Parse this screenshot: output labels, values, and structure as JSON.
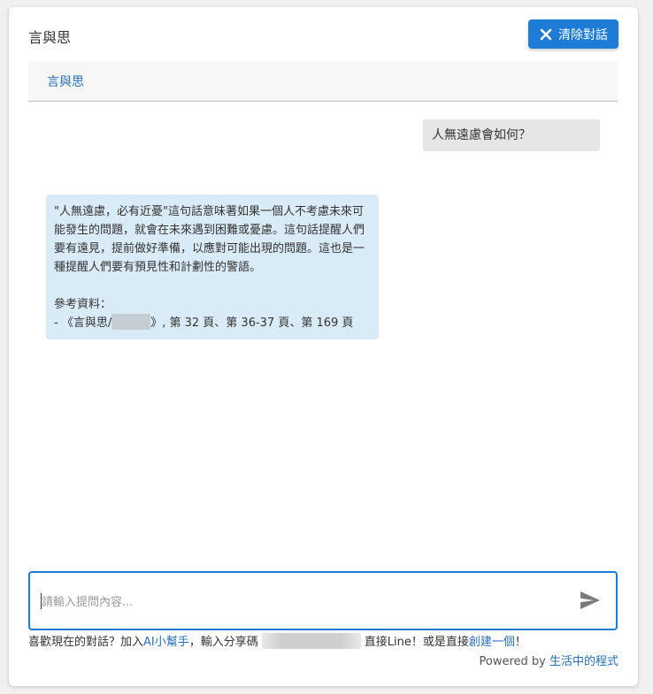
{
  "header": {
    "title": "言與思",
    "clear_button_label": "清除對話"
  },
  "tabs": [
    {
      "label": "言與思"
    }
  ],
  "conversation": {
    "user_message": "人無遠慮會如何？",
    "bot_message": {
      "paragraph": "\"人無遠慮，必有近憂\"這句話意味著如果一個人不考慮未來可能發生的問題，就會在未來遇到困難或憂慮。這句話提醒人們要有遠見，提前做好準備，以應對可能出現的問題。這也是一種提醒人們要有預見性和計劃性的警語。",
      "references_label": "參考資料：",
      "reference_prefix": "- 《言與思/",
      "reference_suffix": "》, 第 32 頁、第 36-37 頁、第 169 頁"
    }
  },
  "input": {
    "placeholder": "請輸入提問內容...",
    "value": ""
  },
  "footer": {
    "text_1": "喜歡現在的對話？加入",
    "link_ai_helper": "AI小幫手",
    "text_2": "，輸入分享碼",
    "text_3": "直接Line！或是直接",
    "link_create": "創建一個",
    "text_4": "！",
    "powered_by": "Powered by ",
    "powered_link": "生活中的程式"
  },
  "colors": {
    "accent": "#1e7bd6",
    "link": "#2a6fb5",
    "bot_bubble": "#d9ebf7",
    "user_bubble": "#e6e6e6"
  },
  "icons": {
    "clear": "close-icon",
    "send": "send-icon"
  }
}
